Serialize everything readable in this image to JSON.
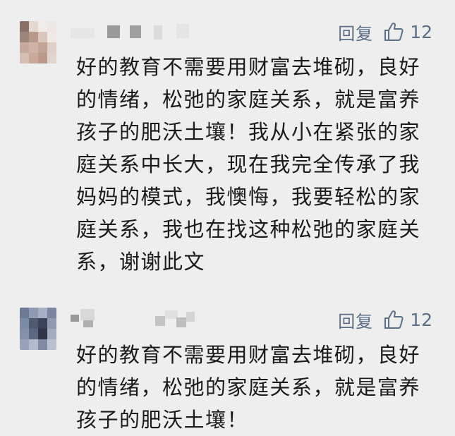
{
  "comments": [
    {
      "reply_label": "回复",
      "like_count": "12",
      "text": "好的教育不需要用财富去堆砌，良好的情绪，松弛的家庭关系，就是富养孩子的肥沃土壤！我从小在紧张的家庭关系中长大，现在我完全传承了我妈妈的模式，我懊悔，我要轻松的家庭关系，我也在找这种松弛的家庭关系，谢谢此文"
    },
    {
      "reply_label": "回复",
      "like_count": "12",
      "text": "好的教育不需要用财富去堆砌，良好的情绪，松弛的家庭关系，就是富养孩子的肥沃土壤！"
    }
  ],
  "colors": {
    "background": "#eeeeee",
    "text": "#1b1b1b",
    "action": "#5b6f86"
  },
  "icons": {
    "like": "thumbs-up-icon"
  }
}
